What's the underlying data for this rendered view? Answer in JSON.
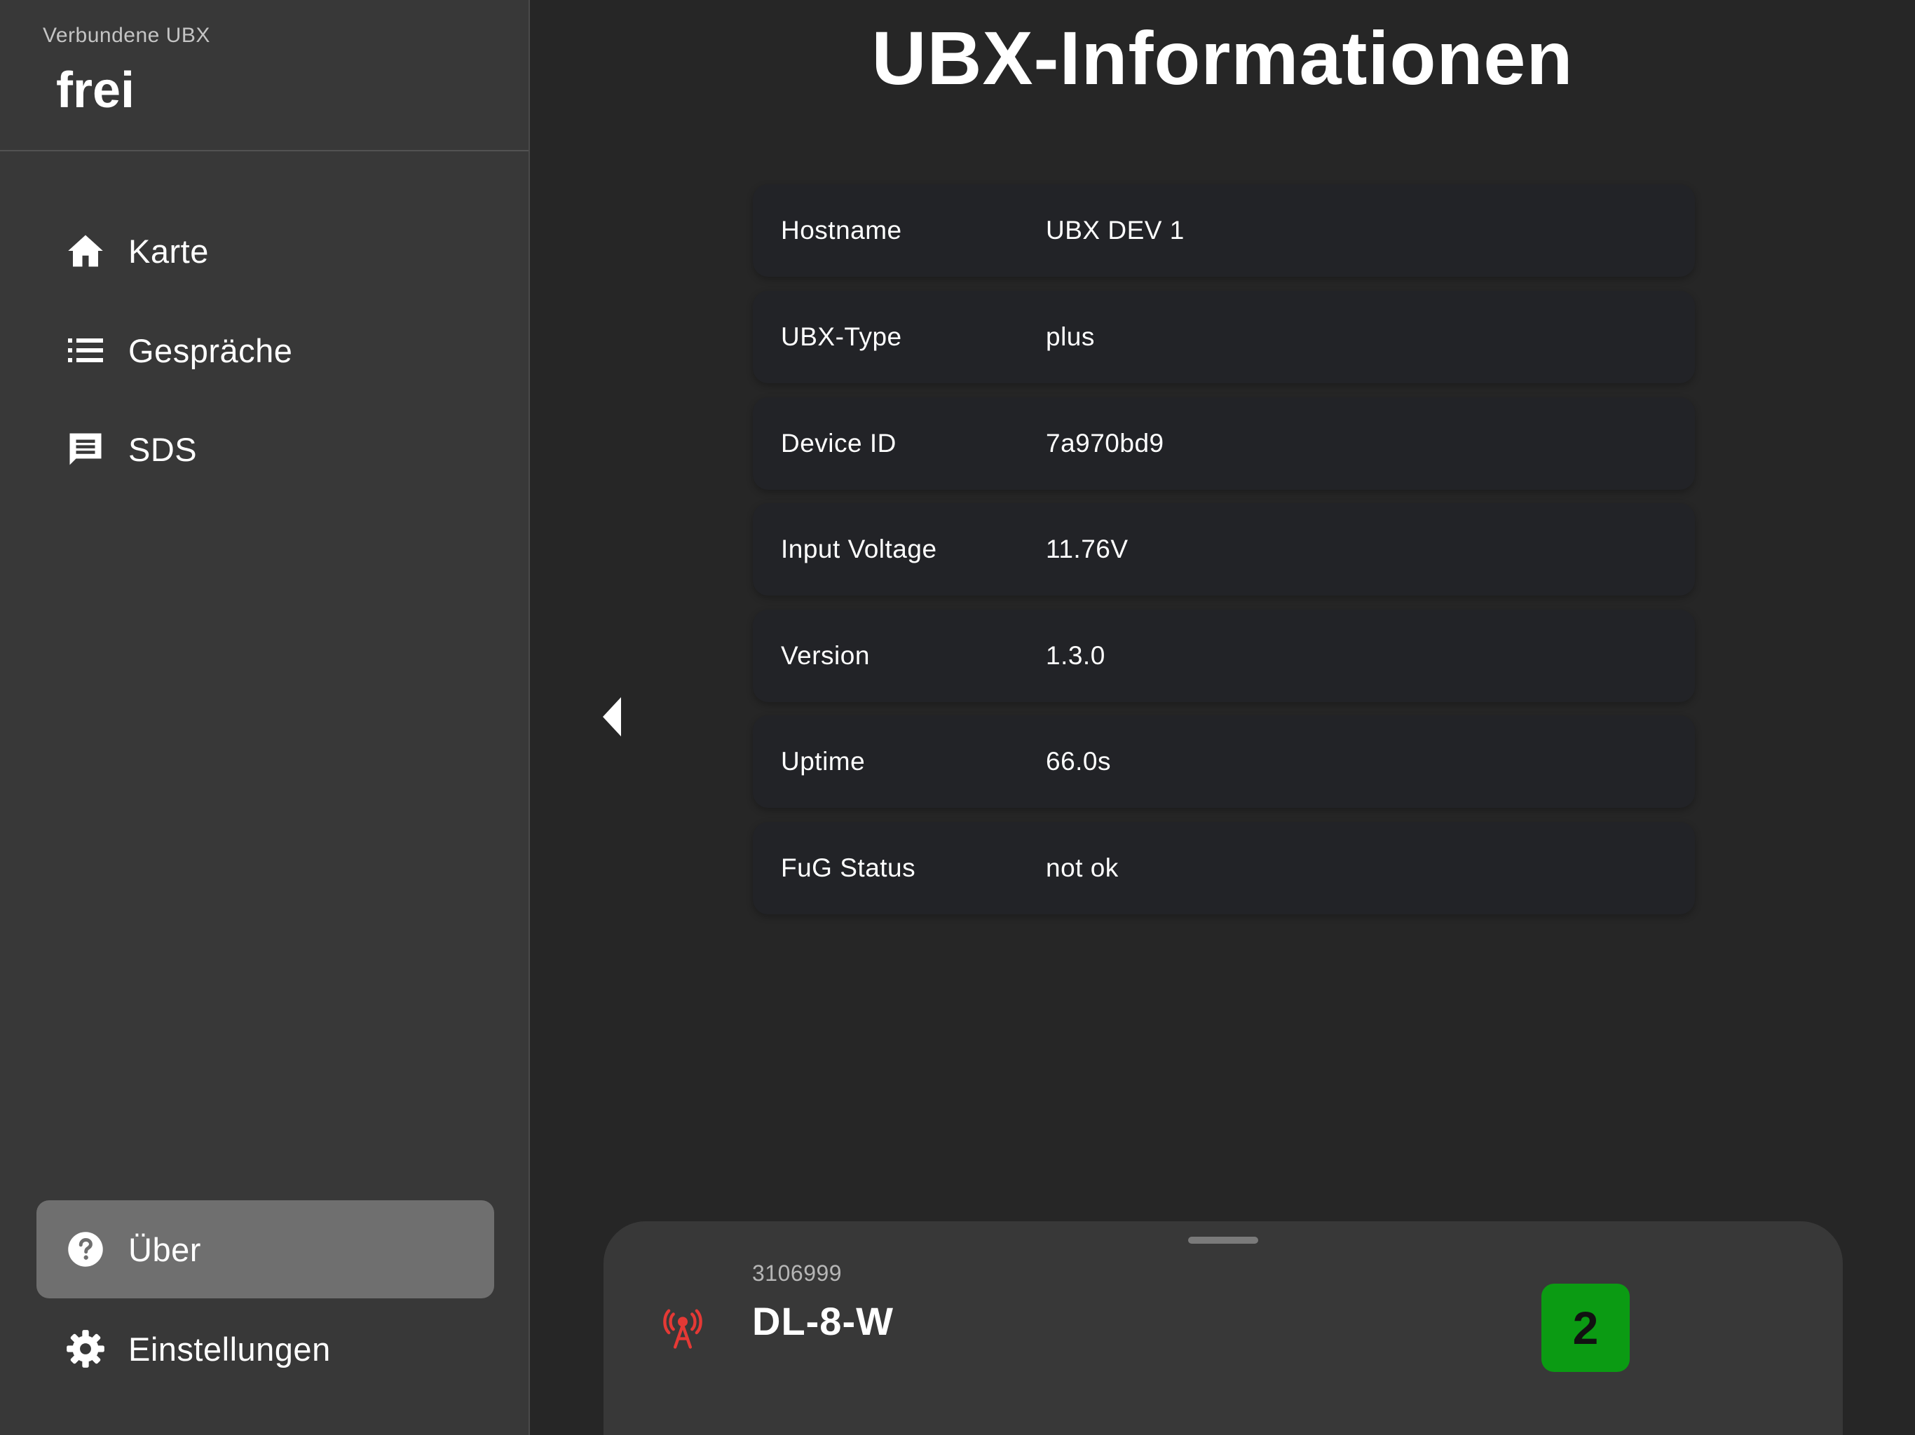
{
  "sidebar": {
    "connected_label": "Verbundene UBX",
    "connected_value": "frei",
    "items": [
      {
        "label": "Karte",
        "icon": "home-icon"
      },
      {
        "label": "Gespräche",
        "icon": "list-icon"
      },
      {
        "label": "SDS",
        "icon": "message-icon"
      },
      {
        "label": "Über",
        "icon": "help-icon",
        "active": true
      },
      {
        "label": "Einstellungen",
        "icon": "gear-icon"
      }
    ]
  },
  "main": {
    "title": "UBX-Informationen",
    "info": [
      {
        "key": "Hostname",
        "value": "UBX DEV 1"
      },
      {
        "key": "UBX-Type",
        "value": "plus"
      },
      {
        "key": "Device ID",
        "value": "7a970bd9"
      },
      {
        "key": "Input Voltage",
        "value": "11.76V"
      },
      {
        "key": "Version",
        "value": "1.3.0"
      },
      {
        "key": "Uptime",
        "value": "66.0s"
      },
      {
        "key": "FuG Status",
        "value": "not ok"
      }
    ]
  },
  "bottom_sheet": {
    "id": "3106999",
    "name": "DL-8-W",
    "badge": "2",
    "icon": "radio-tower-icon",
    "badge_color": "#0b9b13",
    "icon_color": "#e53935"
  },
  "colors": {
    "background": "#262626",
    "sidebar": "#383838",
    "active_item": "#6f6f6f",
    "row": "#222327"
  }
}
